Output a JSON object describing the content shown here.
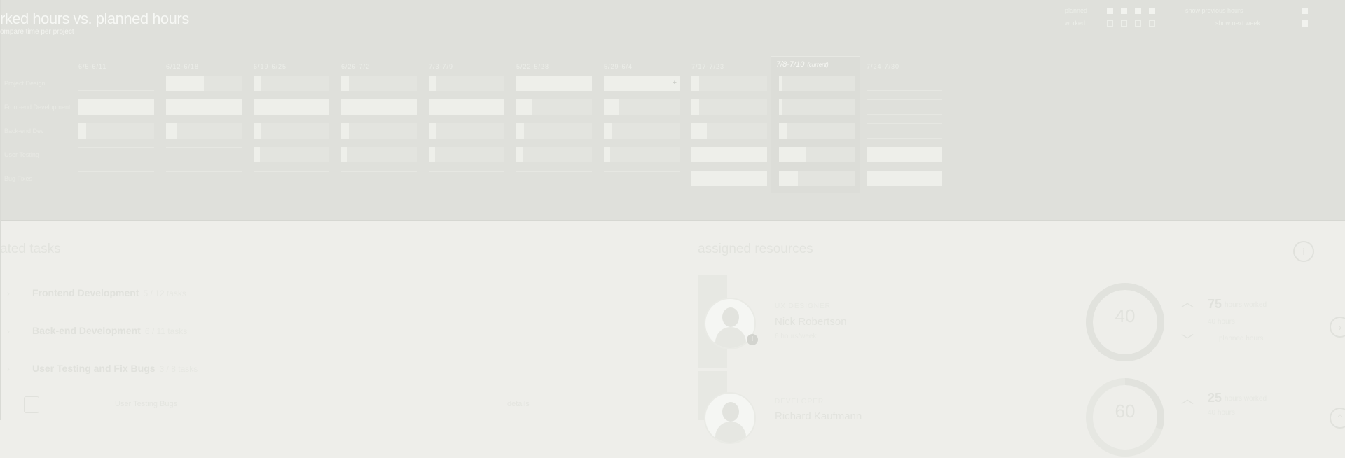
{
  "header": {
    "title": "rked hours vs. planned hours",
    "subtitle": "ompare time per project",
    "legend": {
      "planned_label": "planned",
      "worked_label": "worked",
      "show_previous_label": "show previous hours",
      "show_next_label": "show next week"
    }
  },
  "grid": {
    "columns": [
      "6/5-6/11",
      "6/12-6/18",
      "6/19-6/25",
      "6/26-7/2",
      "7/3-7/9",
      "5/22-5/28",
      "5/29-6/4",
      "7/17-7/23",
      "7/8-7/10",
      "7/24-7/30"
    ],
    "current": {
      "label": "7/8-7/10",
      "tag": "(current)"
    },
    "rows": [
      {
        "label": "Project Design",
        "fills": [
          0,
          0.5,
          0.1,
          0.1,
          0.1,
          1.0,
          1.0,
          0.1,
          0.05,
          0
        ]
      },
      {
        "label": "Front-end Development",
        "fills": [
          1.0,
          1.0,
          1.0,
          1.0,
          1.0,
          0.2,
          0.2,
          0.1,
          0.05,
          0
        ]
      },
      {
        "label": "Back-end Dev",
        "fills": [
          0.1,
          0.15,
          0.1,
          0.1,
          0.1,
          0.1,
          0.1,
          0.2,
          0.1,
          0
        ]
      },
      {
        "label": "User Testing",
        "fills": [
          0,
          0,
          0.08,
          0.08,
          0.08,
          0.08,
          0.08,
          1.0,
          0.35,
          1.0
        ]
      },
      {
        "label": "Bug Fixes",
        "fills": [
          0,
          0,
          0,
          0,
          0,
          0,
          0,
          1.0,
          0.25,
          1.0
        ]
      }
    ],
    "cell_plus": "+"
  },
  "tasks": {
    "section_title": "ated tasks",
    "items": [
      {
        "arrow": "›",
        "name": "Frontend Development",
        "meta": "5 / 12 tasks"
      },
      {
        "arrow": "›",
        "name": "Back-end Development",
        "meta": "6 / 11 tasks"
      },
      {
        "arrow": "›",
        "name": "User Testing and Fix Bugs",
        "meta": "3 / 8 tasks"
      }
    ],
    "footer": {
      "left": "User Testing Bugs",
      "right": "details"
    }
  },
  "resources": {
    "section_title": "assigned resources",
    "info_icon": "i",
    "people": [
      {
        "role": "UX DESIGNER",
        "name": "Nick Robertson",
        "sub": "6 hours/week",
        "gauge_value": "40",
        "gauge_fill": 1.0,
        "stat_top": "75",
        "stat_top_label": "hours worked",
        "stat_mid_label": "40 hours",
        "stat_bottom_label": "planned hours",
        "badge": "!"
      },
      {
        "role": "DEVELOPER",
        "name": "Richard Kaufmann",
        "gauge_value": "60",
        "gauge_fill": 0.3,
        "stat_top": "25",
        "stat_top_label": "hours worked",
        "stat_mid_label": "40 hours"
      }
    ],
    "side_button": "›"
  }
}
